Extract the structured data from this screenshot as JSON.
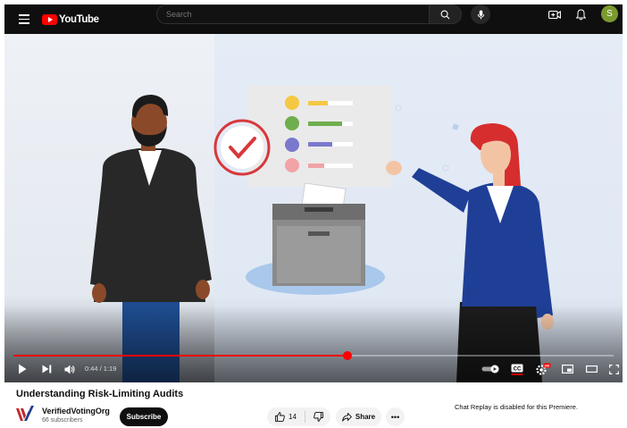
{
  "header": {
    "logo_text": "YouTube",
    "search_placeholder": "Search",
    "avatar_letter": "S",
    "colors": {
      "background": "#0f0f0f",
      "logo_red": "#ff0000",
      "avatar": "#7a9a2e"
    },
    "icons": [
      "menu-icon",
      "youtube-logo",
      "search-icon",
      "mic-icon",
      "create-icon",
      "bell-icon"
    ]
  },
  "player": {
    "time_current": "0:44",
    "time_separator": "/",
    "time_total": "1:19",
    "progress_fraction": 0.557,
    "captions_on": true,
    "autoplay_on": true,
    "hd_badge": "HD",
    "icons": [
      "play-icon",
      "next-icon",
      "volume-icon",
      "autoplay-toggle",
      "captions-icon",
      "settings-icon",
      "miniplayer-icon",
      "theater-icon",
      "fullscreen-icon"
    ],
    "colors": {
      "progress": "#ff0000"
    }
  },
  "video": {
    "title": "Understanding Risk-Limiting Audits"
  },
  "channel": {
    "name": "VerifiedVotingOrg",
    "subscribers": "66 subscribers",
    "subscribe_label": "Subscribe"
  },
  "actions": {
    "like_count": "14",
    "share_label": "Share",
    "more_label": "•••"
  },
  "chat": {
    "note": "Chat Replay is disabled for this Premiere."
  }
}
